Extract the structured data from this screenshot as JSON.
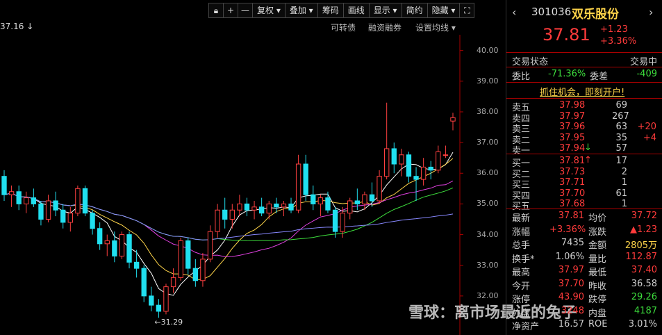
{
  "toolbar": {
    "lock_icon": "lock-icon",
    "plus": "+",
    "minus": "—",
    "fq": "复权 ▾",
    "overlay": "叠加 ▾",
    "chip": "筹码",
    "draw": "画线",
    "display": "显示 ▾",
    "simple": "简约",
    "hide": "隐藏 ▾",
    "expand_icon": "expand-icon"
  },
  "subbar": {
    "top_value": "37.16",
    "convertible": "可转债",
    "margin": "融资融券",
    "set_ma": "设置均线 ▾"
  },
  "axis_labels": [
    "40.00",
    "39.00",
    "38.00",
    "37.00",
    "36.00",
    "35.00",
    "34.00",
    "33.00",
    "32.00"
  ],
  "low_label": "31.29",
  "stock": {
    "code": "301036",
    "name": "双乐股份",
    "price": "37.81",
    "change": "+1.23",
    "change_pct": "+3.36%"
  },
  "status": {
    "label": "交易状态",
    "value": "交易中"
  },
  "ratio": {
    "wb_label": "委比",
    "wb": "-71.36%",
    "wc_label": "委差",
    "wc": "-409"
  },
  "promo": "抓住机会，即刻开户!",
  "asks": [
    {
      "label": "卖五",
      "price": "37.98",
      "vol": "69",
      "chg": ""
    },
    {
      "label": "卖四",
      "price": "37.97",
      "vol": "267",
      "chg": ""
    },
    {
      "label": "卖三",
      "price": "37.96",
      "vol": "63",
      "chg": "+20"
    },
    {
      "label": "卖二",
      "price": "37.95",
      "vol": "35",
      "chg": "+4"
    },
    {
      "label": "卖一",
      "price": "37.94",
      "vol": "57",
      "chg": ""
    }
  ],
  "bids": [
    {
      "label": "买一",
      "price": "37.81",
      "vol": "17"
    },
    {
      "label": "买二",
      "price": "37.73",
      "vol": "2"
    },
    {
      "label": "买三",
      "price": "37.71",
      "vol": "1"
    },
    {
      "label": "买四",
      "price": "37.70",
      "vol": "61"
    },
    {
      "label": "买五",
      "price": "37.68",
      "vol": "1"
    }
  ],
  "quote": [
    {
      "l1": "最新",
      "v1": "37.81",
      "l2": "均价",
      "v2": "37.72",
      "c1": "red",
      "c2": "red"
    },
    {
      "l1": "涨幅",
      "v1": "+3.36%",
      "l2": "涨跌",
      "v2": "▲1.23",
      "c1": "red",
      "c2": "red"
    },
    {
      "l1": "总手",
      "v1": "7435",
      "l2": "金额",
      "v2": "2805万",
      "c1": "gray",
      "c2": "yellow"
    },
    {
      "l1": "换手*",
      "v1": "1.06%",
      "l2": "量比",
      "v2": "112.87",
      "c1": "gray",
      "c2": "red"
    },
    {
      "l1": "最高",
      "v1": "37.97",
      "l2": "最低",
      "v2": "37.40",
      "c1": "red",
      "c2": "red"
    },
    {
      "l1": "今开",
      "v1": "37.70",
      "l2": "昨收",
      "v2": "36.58",
      "c1": "red",
      "c2": "gray"
    },
    {
      "l1": "涨停",
      "v1": "43.90",
      "l2": "跌停",
      "v2": "29.26",
      "c1": "red",
      "c2": "green"
    },
    {
      "l1": "外盘",
      "v1": "3248",
      "l2": "内盘",
      "v2": "4187",
      "c1": "red",
      "c2": "green"
    },
    {
      "l1": "净资产",
      "v1": "16.57",
      "l2": "ROE",
      "v2": "3.01%",
      "c1": "gray",
      "c2": "gray"
    }
  ],
  "watermark": "雪球：离市场最近的兔子",
  "chart_data": {
    "type": "candlestick",
    "ylim": [
      31.0,
      40.4
    ],
    "candles": [
      [
        35.9,
        36.1,
        35.1,
        35.3
      ],
      [
        35.3,
        35.6,
        34.9,
        35.4
      ],
      [
        35.4,
        35.6,
        34.8,
        35.0
      ],
      [
        35.0,
        35.4,
        34.7,
        35.2
      ],
      [
        35.2,
        35.5,
        34.9,
        35.0
      ],
      [
        35.0,
        35.1,
        34.3,
        34.5
      ],
      [
        34.5,
        35.3,
        34.4,
        35.1
      ],
      [
        35.1,
        35.4,
        34.6,
        34.8
      ],
      [
        34.8,
        35.0,
        34.2,
        34.4
      ],
      [
        34.4,
        34.9,
        34.1,
        34.7
      ],
      [
        34.7,
        35.6,
        34.6,
        35.5
      ],
      [
        35.5,
        35.6,
        34.6,
        34.7
      ],
      [
        34.7,
        34.8,
        34.0,
        34.2
      ],
      [
        34.2,
        34.4,
        33.5,
        33.7
      ],
      [
        33.7,
        34.0,
        33.3,
        33.8
      ],
      [
        33.8,
        34.1,
        33.1,
        33.3
      ],
      [
        33.3,
        34.1,
        33.2,
        34.0
      ],
      [
        34.0,
        34.1,
        32.9,
        33.1
      ],
      [
        33.1,
        33.5,
        32.6,
        32.9
      ],
      [
        32.9,
        33.0,
        31.8,
        32.0
      ],
      [
        32.0,
        32.3,
        31.5,
        31.7
      ],
      [
        31.7,
        31.9,
        31.29,
        31.5
      ],
      [
        31.5,
        32.4,
        31.4,
        32.3
      ],
      [
        32.3,
        32.9,
        32.1,
        32.6
      ],
      [
        32.6,
        33.9,
        32.5,
        33.8
      ],
      [
        33.8,
        33.9,
        32.7,
        32.9
      ],
      [
        32.9,
        33.2,
        32.3,
        32.5
      ],
      [
        32.5,
        33.4,
        32.3,
        33.2
      ],
      [
        33.2,
        34.3,
        33.1,
        34.1
      ],
      [
        34.1,
        35.0,
        33.9,
        34.8
      ],
      [
        34.8,
        35.2,
        34.2,
        34.5
      ],
      [
        34.5,
        35.0,
        34.2,
        34.8
      ],
      [
        34.8,
        35.3,
        34.6,
        35.0
      ],
      [
        35.0,
        35.2,
        34.6,
        34.8
      ],
      [
        34.8,
        35.1,
        34.5,
        34.9
      ],
      [
        34.9,
        35.2,
        34.6,
        34.7
      ],
      [
        34.7,
        35.1,
        34.5,
        35.0
      ],
      [
        35.0,
        35.2,
        34.7,
        34.9
      ],
      [
        34.9,
        35.1,
        34.6,
        35.0
      ],
      [
        35.0,
        35.2,
        34.7,
        34.8
      ],
      [
        34.8,
        36.6,
        34.7,
        36.3
      ],
      [
        36.3,
        36.6,
        35.1,
        35.3
      ],
      [
        35.3,
        35.6,
        34.8,
        35.0
      ],
      [
        35.0,
        35.3,
        34.6,
        35.2
      ],
      [
        35.2,
        35.4,
        34.7,
        34.8
      ],
      [
        34.8,
        34.9,
        33.9,
        34.1
      ],
      [
        34.1,
        34.9,
        33.9,
        34.7
      ],
      [
        34.7,
        35.2,
        34.5,
        35.1
      ],
      [
        35.1,
        35.5,
        34.8,
        35.0
      ],
      [
        35.0,
        35.4,
        34.8,
        35.3
      ],
      [
        35.3,
        35.7,
        34.9,
        35.1
      ],
      [
        35.1,
        36.1,
        35.0,
        35.9
      ],
      [
        35.9,
        38.3,
        35.8,
        36.8
      ],
      [
        36.8,
        37.0,
        36.0,
        36.3
      ],
      [
        36.3,
        36.8,
        35.9,
        36.6
      ],
      [
        36.6,
        36.7,
        35.7,
        35.9
      ],
      [
        35.9,
        36.2,
        35.1,
        35.8
      ],
      [
        35.8,
        36.5,
        35.6,
        36.2
      ],
      [
        36.2,
        36.4,
        35.8,
        36.1
      ],
      [
        36.1,
        36.9,
        36.0,
        36.7
      ],
      [
        36.58,
        36.9,
        36.5,
        36.6
      ],
      [
        37.7,
        37.97,
        37.4,
        37.81
      ]
    ]
  }
}
